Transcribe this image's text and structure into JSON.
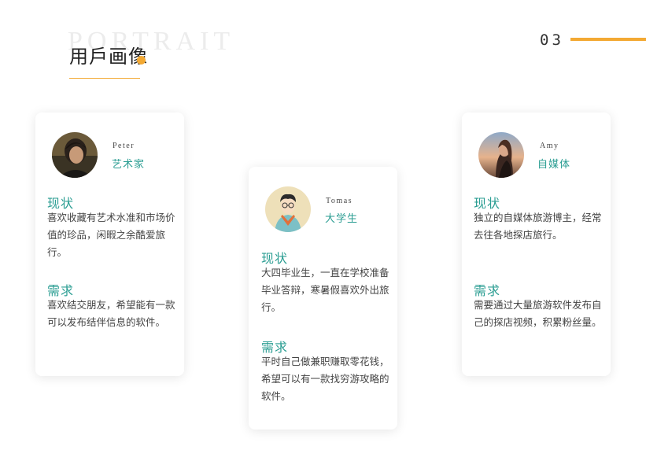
{
  "header": {
    "bg_word": "PORTRAIT",
    "title": "用戶画像",
    "page_number": "03",
    "accent_color": "#f3a933"
  },
  "theme": {
    "teal": "#2a9d92"
  },
  "personas": [
    {
      "name": "Peter",
      "role": "艺术家",
      "status_title": "现状",
      "status_text": "喜欢收藏有艺术水准和市场价值的珍品，闲暇之余酷爱旅行。",
      "need_title": "需求",
      "need_text": "喜欢结交朋友，希望能有一款可以发布结伴信息的软件。",
      "avatar_icon": "person-photo-icon"
    },
    {
      "name": "Tomas",
      "role": "大学生",
      "status_title": "现状",
      "status_text": "大四毕业生，一直在学校准备毕业答辩，寒暑假喜欢外出旅行。",
      "need_title": "需求",
      "need_text": "平时自己做兼职赚取零花钱，希望可以有一款找穷游攻略的软件。",
      "avatar_icon": "illustrated-person-icon"
    },
    {
      "name": "Amy",
      "role": "自媒体",
      "status_title": "现状",
      "status_text": "独立的自媒体旅游博主，经常去往各地探店旅行。",
      "need_title": "需求",
      "need_text": "需要通过大量旅游软件发布自己的探店视频，积累粉丝量。",
      "avatar_icon": "person-photo-icon"
    }
  ]
}
